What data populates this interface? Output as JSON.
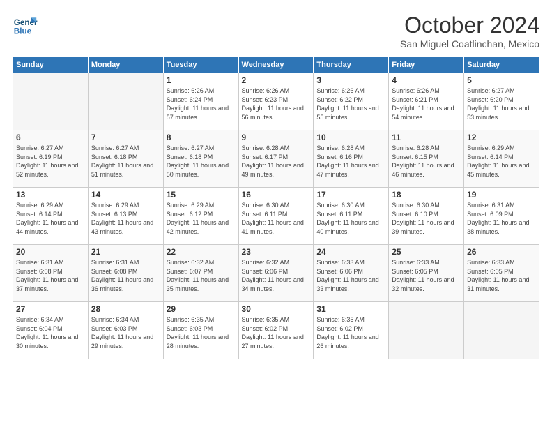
{
  "logo": {
    "line1": "General",
    "line2": "Blue"
  },
  "title": "October 2024",
  "location": "San Miguel Coatlinchan, Mexico",
  "days_of_week": [
    "Sunday",
    "Monday",
    "Tuesday",
    "Wednesday",
    "Thursday",
    "Friday",
    "Saturday"
  ],
  "weeks": [
    [
      {
        "day": "",
        "info": ""
      },
      {
        "day": "",
        "info": ""
      },
      {
        "day": "1",
        "info": "Sunrise: 6:26 AM\nSunset: 6:24 PM\nDaylight: 11 hours and 57 minutes."
      },
      {
        "day": "2",
        "info": "Sunrise: 6:26 AM\nSunset: 6:23 PM\nDaylight: 11 hours and 56 minutes."
      },
      {
        "day": "3",
        "info": "Sunrise: 6:26 AM\nSunset: 6:22 PM\nDaylight: 11 hours and 55 minutes."
      },
      {
        "day": "4",
        "info": "Sunrise: 6:26 AM\nSunset: 6:21 PM\nDaylight: 11 hours and 54 minutes."
      },
      {
        "day": "5",
        "info": "Sunrise: 6:27 AM\nSunset: 6:20 PM\nDaylight: 11 hours and 53 minutes."
      }
    ],
    [
      {
        "day": "6",
        "info": "Sunrise: 6:27 AM\nSunset: 6:19 PM\nDaylight: 11 hours and 52 minutes."
      },
      {
        "day": "7",
        "info": "Sunrise: 6:27 AM\nSunset: 6:18 PM\nDaylight: 11 hours and 51 minutes."
      },
      {
        "day": "8",
        "info": "Sunrise: 6:27 AM\nSunset: 6:18 PM\nDaylight: 11 hours and 50 minutes."
      },
      {
        "day": "9",
        "info": "Sunrise: 6:28 AM\nSunset: 6:17 PM\nDaylight: 11 hours and 49 minutes."
      },
      {
        "day": "10",
        "info": "Sunrise: 6:28 AM\nSunset: 6:16 PM\nDaylight: 11 hours and 47 minutes."
      },
      {
        "day": "11",
        "info": "Sunrise: 6:28 AM\nSunset: 6:15 PM\nDaylight: 11 hours and 46 minutes."
      },
      {
        "day": "12",
        "info": "Sunrise: 6:29 AM\nSunset: 6:14 PM\nDaylight: 11 hours and 45 minutes."
      }
    ],
    [
      {
        "day": "13",
        "info": "Sunrise: 6:29 AM\nSunset: 6:14 PM\nDaylight: 11 hours and 44 minutes."
      },
      {
        "day": "14",
        "info": "Sunrise: 6:29 AM\nSunset: 6:13 PM\nDaylight: 11 hours and 43 minutes."
      },
      {
        "day": "15",
        "info": "Sunrise: 6:29 AM\nSunset: 6:12 PM\nDaylight: 11 hours and 42 minutes."
      },
      {
        "day": "16",
        "info": "Sunrise: 6:30 AM\nSunset: 6:11 PM\nDaylight: 11 hours and 41 minutes."
      },
      {
        "day": "17",
        "info": "Sunrise: 6:30 AM\nSunset: 6:11 PM\nDaylight: 11 hours and 40 minutes."
      },
      {
        "day": "18",
        "info": "Sunrise: 6:30 AM\nSunset: 6:10 PM\nDaylight: 11 hours and 39 minutes."
      },
      {
        "day": "19",
        "info": "Sunrise: 6:31 AM\nSunset: 6:09 PM\nDaylight: 11 hours and 38 minutes."
      }
    ],
    [
      {
        "day": "20",
        "info": "Sunrise: 6:31 AM\nSunset: 6:08 PM\nDaylight: 11 hours and 37 minutes."
      },
      {
        "day": "21",
        "info": "Sunrise: 6:31 AM\nSunset: 6:08 PM\nDaylight: 11 hours and 36 minutes."
      },
      {
        "day": "22",
        "info": "Sunrise: 6:32 AM\nSunset: 6:07 PM\nDaylight: 11 hours and 35 minutes."
      },
      {
        "day": "23",
        "info": "Sunrise: 6:32 AM\nSunset: 6:06 PM\nDaylight: 11 hours and 34 minutes."
      },
      {
        "day": "24",
        "info": "Sunrise: 6:33 AM\nSunset: 6:06 PM\nDaylight: 11 hours and 33 minutes."
      },
      {
        "day": "25",
        "info": "Sunrise: 6:33 AM\nSunset: 6:05 PM\nDaylight: 11 hours and 32 minutes."
      },
      {
        "day": "26",
        "info": "Sunrise: 6:33 AM\nSunset: 6:05 PM\nDaylight: 11 hours and 31 minutes."
      }
    ],
    [
      {
        "day": "27",
        "info": "Sunrise: 6:34 AM\nSunset: 6:04 PM\nDaylight: 11 hours and 30 minutes."
      },
      {
        "day": "28",
        "info": "Sunrise: 6:34 AM\nSunset: 6:03 PM\nDaylight: 11 hours and 29 minutes."
      },
      {
        "day": "29",
        "info": "Sunrise: 6:35 AM\nSunset: 6:03 PM\nDaylight: 11 hours and 28 minutes."
      },
      {
        "day": "30",
        "info": "Sunrise: 6:35 AM\nSunset: 6:02 PM\nDaylight: 11 hours and 27 minutes."
      },
      {
        "day": "31",
        "info": "Sunrise: 6:35 AM\nSunset: 6:02 PM\nDaylight: 11 hours and 26 minutes."
      },
      {
        "day": "",
        "info": ""
      },
      {
        "day": "",
        "info": ""
      }
    ]
  ]
}
